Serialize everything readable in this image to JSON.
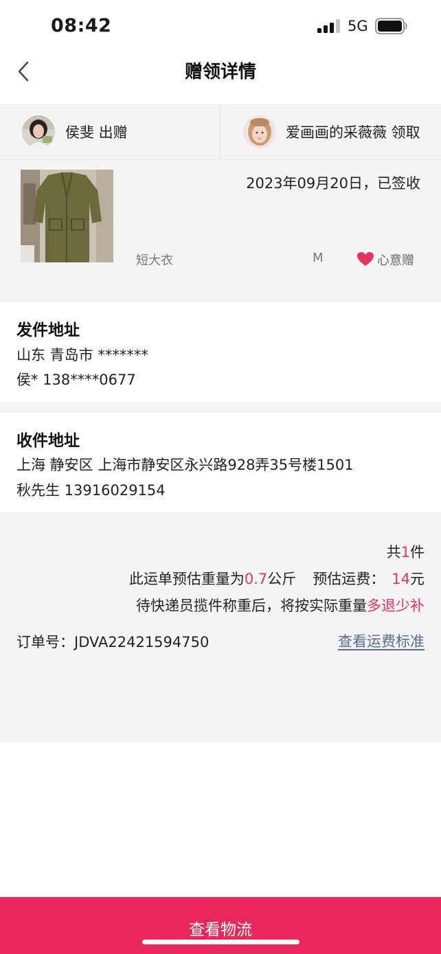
{
  "status_bar": {
    "time": "08:42",
    "network": "5G"
  },
  "nav": {
    "title": "赠领详情",
    "back_icon": "chevron-left-icon"
  },
  "parties": {
    "giver": {
      "name_action": "侯斐 出赠"
    },
    "receiver": {
      "name_action": "爱画画的采薇薇 领取"
    }
  },
  "item": {
    "date_status": "2023年09月20日，已签收",
    "name": "短大衣",
    "size": "M",
    "gift_type": "心意赠",
    "heart_color": "#e8325e"
  },
  "sender_address": {
    "label": "发件地址",
    "location": "山东 青岛市 *******",
    "contact": "侯* 138****0677"
  },
  "receiver_address": {
    "label": "收件地址",
    "location": "上海 静安区 上海市静安区永兴路928弄35号楼1501",
    "contact": "秋先生 13916029154"
  },
  "shipping": {
    "count_prefix": "共",
    "count": "1",
    "count_suffix": "件",
    "weight_prefix": "此运单预估重量为",
    "weight_value": "0.7",
    "weight_unit": "公斤",
    "fee_label": "预估运费：",
    "fee_value": "14",
    "fee_unit": "元",
    "note_prefix": "待快递员揽件称重后，将按实际重量",
    "note_highlight": "多退少补",
    "order_label": "订单号：",
    "order_number": "JDVA22421594750",
    "fee_standard_link": "查看运费标准",
    "accent_color": "#e8325e"
  },
  "bottom_button": {
    "label": "查看物流",
    "color": "#e8285a"
  }
}
